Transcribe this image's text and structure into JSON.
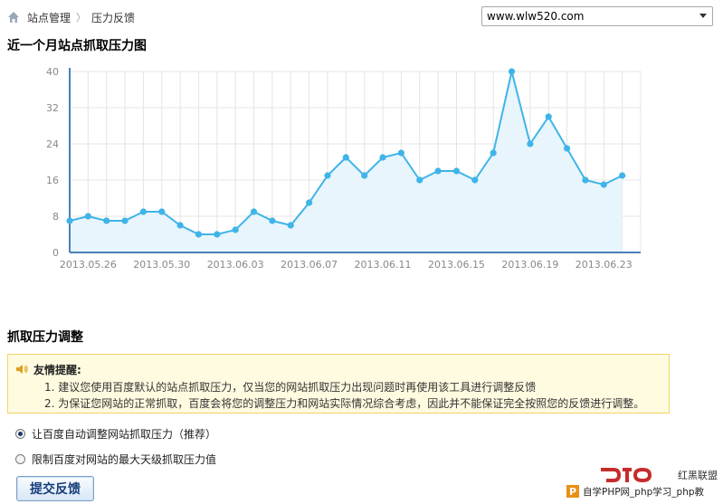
{
  "breadcrumb": {
    "home_icon": "home-icon",
    "item1": "站点管理",
    "separator": "〉",
    "item2": "压力反馈"
  },
  "site_select": {
    "value": "www.wlw520.com"
  },
  "chart_section": {
    "title": "近一个月站点抓取压力图"
  },
  "chart_data": {
    "type": "area",
    "x": [
      "2013.05.25",
      "2013.05.26",
      "2013.05.27",
      "2013.05.28",
      "2013.05.29",
      "2013.05.30",
      "2013.05.31",
      "2013.06.01",
      "2013.06.02",
      "2013.06.03",
      "2013.06.04",
      "2013.06.05",
      "2013.06.06",
      "2013.06.07",
      "2013.06.08",
      "2013.06.09",
      "2013.06.10",
      "2013.06.11",
      "2013.06.12",
      "2013.06.13",
      "2013.06.14",
      "2013.06.15",
      "2013.06.16",
      "2013.06.17",
      "2013.06.18",
      "2013.06.19",
      "2013.06.20",
      "2013.06.21",
      "2013.06.22",
      "2013.06.23",
      "2013.06.24",
      "2013.06.25"
    ],
    "values": [
      7,
      8,
      7,
      7,
      9,
      9,
      6,
      4,
      4,
      5,
      9,
      7,
      6,
      11,
      17,
      21,
      17,
      21,
      22,
      16,
      18,
      18,
      16,
      22,
      40,
      24,
      30,
      23,
      16,
      15,
      17
    ],
    "x_tick_labels": [
      "2013.05.26",
      "2013.05.30",
      "2013.06.03",
      "2013.06.07",
      "2013.06.11",
      "2013.06.15",
      "2013.06.19",
      "2013.06.23"
    ],
    "y_ticks": [
      0,
      8,
      16,
      24,
      32,
      40
    ],
    "ylim": [
      0,
      40
    ],
    "grid": true,
    "line_color": "#3fb4e8",
    "fill_color": "#e8f5fc"
  },
  "adjust_section": {
    "title": "抓取压力调整"
  },
  "tips": {
    "icon": "speaker-icon",
    "title": "友情提醒:",
    "line1": "1. 建议您使用百度默认的站点抓取压力，仅当您的网站抓取压力出现问题时再使用该工具进行调整反馈",
    "line2": "2. 为保证您网站的正常抓取，百度会将您的调整压力和网站实际情况综合考虑，因此并不能保证完全按照您的反馈进行调整。"
  },
  "options": [
    {
      "label": "让百度自动调整网站抓取压力（推荐）",
      "checked": true
    },
    {
      "label": "限制百度对网站的最大天级抓取压力值",
      "checked": false
    }
  ],
  "submit_label": "提交反馈",
  "watermark": {
    "text": "自学PHP网_php学习_php教",
    "logo_text": "红黑联盟"
  }
}
